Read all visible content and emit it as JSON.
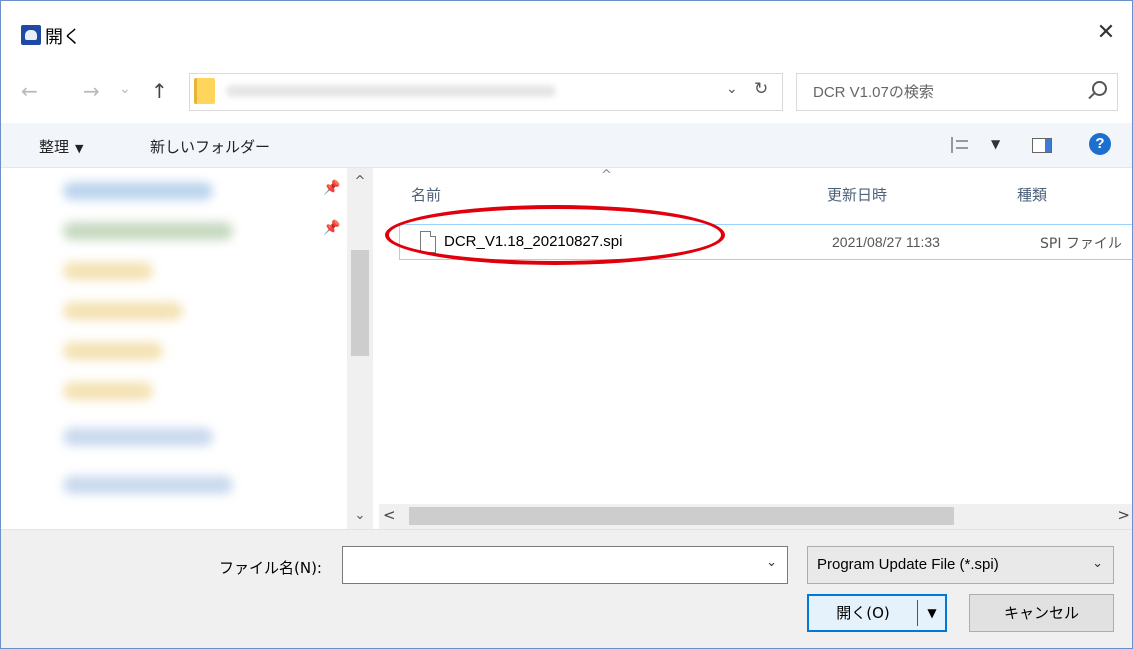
{
  "window": {
    "title": "開く",
    "close_glyph": "✕"
  },
  "nav": {
    "back_glyph": "←",
    "forward_glyph": "→",
    "recent_glyph": "⌄",
    "up_glyph": "↑",
    "address_dropdown_glyph": "⌄",
    "refresh_glyph": "↻"
  },
  "search": {
    "placeholder": "DCR V1.07の検索"
  },
  "toolbar": {
    "organize_label": "整理",
    "organize_caret": "▼",
    "new_folder_label": "新しいフォルダー",
    "view_caret": "▼",
    "help_glyph": "?"
  },
  "sidebar": {
    "pin_glyph": "📌",
    "scroll_up_glyph": "^",
    "scroll_down_glyph": "⌄"
  },
  "file_list": {
    "columns": [
      "名前",
      "更新日時",
      "種類"
    ],
    "sort_glyph": "^",
    "rows": [
      {
        "name": "DCR_V1.18_20210827.spi",
        "modified": "2021/08/27 11:33",
        "type": "SPI ファイル"
      }
    ],
    "scroll_left_glyph": "<",
    "scroll_right_glyph": ">"
  },
  "footer": {
    "filename_label": "ファイル名(N):",
    "filename_value": "",
    "filename_dropdown_glyph": "⌄",
    "filetype_selected": "Program Update File (*.spi)",
    "filetype_dropdown_glyph": "⌄",
    "open_label": "開く(O)",
    "open_caret": "▼",
    "cancel_label": "キャンセル"
  },
  "colors": {
    "highlight": "#e0000b",
    "selection_border": "#99d1ff",
    "accent": "#0078d7"
  }
}
